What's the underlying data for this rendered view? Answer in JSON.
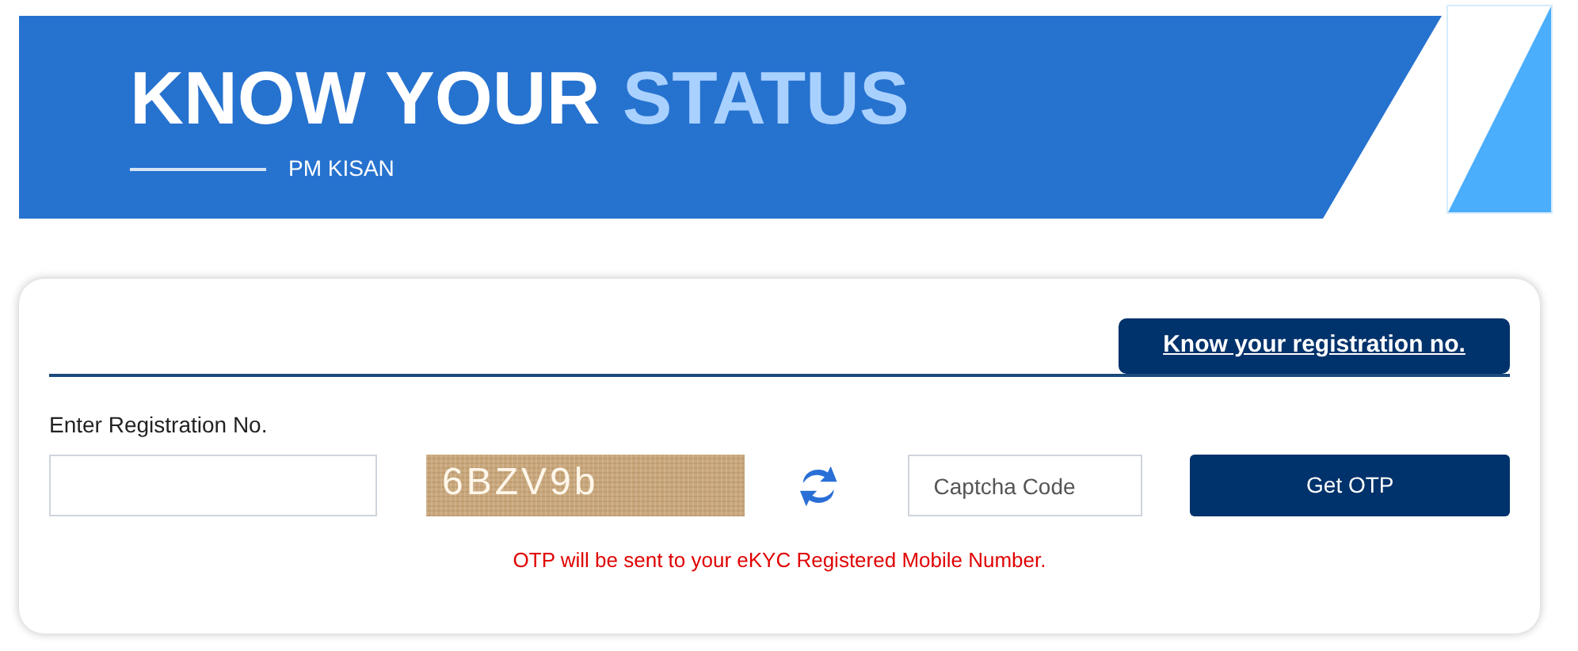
{
  "header": {
    "title": "KNOW YOUR",
    "title_highlight": "STATUS",
    "subtitle": "PM KISAN"
  },
  "form": {
    "link_button": "Know your registration no.",
    "registration_label": "Enter Registration No.",
    "captcha_text": "6BZV9b",
    "captcha_field": {
      "placeholder": "Captcha Code"
    },
    "submit_button": "Get OTP",
    "note": "OTP will be sent to your eKYC Registered Mobile Number."
  }
}
